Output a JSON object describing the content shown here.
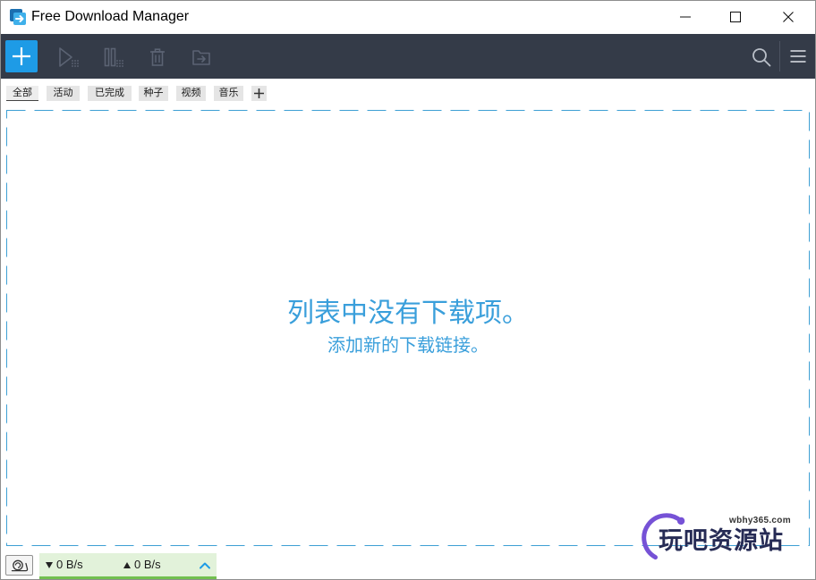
{
  "window": {
    "title": "Free Download Manager",
    "app_icon": "fdm-app-icon",
    "controls": {
      "minimize_icon": "minimize-icon",
      "maximize_icon": "maximize-icon",
      "close_icon": "close-icon"
    }
  },
  "toolbar": {
    "buttons": [
      {
        "icon": "plus-icon",
        "enabled": true
      },
      {
        "icon": "play-icon",
        "enabled": false
      },
      {
        "icon": "pause-icon",
        "enabled": false
      },
      {
        "icon": "trash-icon",
        "enabled": false
      },
      {
        "icon": "folder-move-icon",
        "enabled": false
      }
    ],
    "search_icon": "search-icon",
    "menu_icon": "hamburger-menu-icon"
  },
  "filters": {
    "tabs": [
      {
        "label": "全部",
        "selected": true
      },
      {
        "label": "活动",
        "selected": false
      },
      {
        "label": "已完成",
        "selected": false
      },
      {
        "label": "种子",
        "selected": false
      },
      {
        "label": "视频",
        "selected": false
      },
      {
        "label": "音乐",
        "selected": false
      }
    ],
    "add_icon": "plus-icon"
  },
  "download_list": {
    "empty_title": "列表中没有下载项。",
    "empty_subtitle": "添加新的下载链接。"
  },
  "status_bar": {
    "speed_limit_icon": "snail-icon",
    "download_icon": "triangle-down-icon",
    "download_speed": "0 B/s",
    "upload_icon": "triangle-up-icon",
    "upload_speed": "0 B/s",
    "expand_icon": "chevron-up-icon"
  },
  "watermark": {
    "domain": "wbhy365.com",
    "name": "玩吧资源站"
  },
  "colors": {
    "accent": "#1e9be6",
    "toolbar_bg": "#343b48",
    "empty_text": "#3a9fdb",
    "dashed_border": "#3e9fd4",
    "speed_panel_bg": "#e2f2da",
    "speed_panel_bar": "#72c04f",
    "watermark_ring": "#7652d6",
    "watermark_text": "#262b55"
  }
}
